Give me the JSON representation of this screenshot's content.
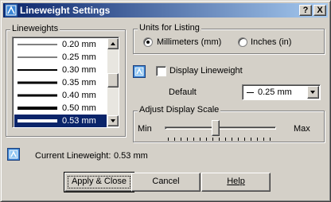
{
  "window": {
    "title": "Lineweight Settings",
    "help_button": "?",
    "close_button": "X"
  },
  "lineweights": {
    "legend": "Lineweights",
    "items": [
      {
        "label": "0.20 mm",
        "thickness": 1
      },
      {
        "label": "0.25 mm",
        "thickness": 1
      },
      {
        "label": "0.30 mm",
        "thickness": 2
      },
      {
        "label": "0.35 mm",
        "thickness": 3
      },
      {
        "label": "0.40 mm",
        "thickness": 3
      },
      {
        "label": "0.50 mm",
        "thickness": 4
      },
      {
        "label": "0.53 mm",
        "thickness": 4
      }
    ],
    "selected": "0.53 mm"
  },
  "units": {
    "legend": "Units for Listing",
    "millimeters": {
      "label": "Millimeters (mm)",
      "checked": true
    },
    "inches": {
      "label": "Inches (in)",
      "checked": false
    }
  },
  "display_lineweight": {
    "label": "Display Lineweight",
    "checked": false
  },
  "default": {
    "label": "Default",
    "value": "0.25 mm"
  },
  "display_scale": {
    "legend": "Adjust Display Scale",
    "min_label": "Min",
    "max_label": "Max",
    "position_fraction": 0.43
  },
  "current": {
    "label": "Current Lineweight:",
    "value": "0.53 mm"
  },
  "buttons": {
    "apply_close": "Apply & Close",
    "cancel": "Cancel",
    "help": "Help"
  },
  "colors": {
    "title_bar_start": "#0a246a",
    "title_bar_end": "#a6caf0",
    "selection": "#0a246a",
    "face": "#d4d0c8"
  }
}
